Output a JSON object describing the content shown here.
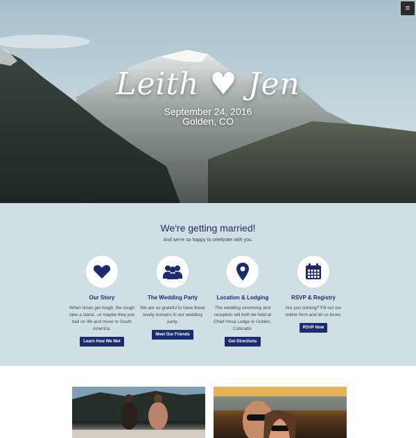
{
  "hero": {
    "names": "Leith ♥ Jen",
    "date": "September 24, 2016",
    "location": "Golden, CO"
  },
  "menu": {
    "icon": "hamburger-menu-icon",
    "glyph": "≡"
  },
  "intro": {
    "title": "We're getting married!",
    "subtitle": "And we're so happy to celebrate with you."
  },
  "features": [
    {
      "icon": "heart-icon",
      "title": "Our Story",
      "description": "When times get tough, the tough take a stand...or maybe they just bail on life and move to South America.",
      "button": "Learn How We Met"
    },
    {
      "icon": "group-icon",
      "title": "The Wedding Party",
      "description": "We are so grateful to have these lovely humans in our wedding party.",
      "button": "Meet Our Friends"
    },
    {
      "icon": "map-pin-icon",
      "title": "Location & Lodging",
      "description": "The wedding ceremony and reception will both be held at Chief Hosa Lodge in Golden, Colorado.",
      "button": "Get Directions"
    },
    {
      "icon": "calendar-icon",
      "title": "RSVP & Registry",
      "description": "Are you coming? Fill out our online form and let us know.",
      "button": "RSVP Now"
    }
  ],
  "colors": {
    "navy": "#1b2b6e",
    "section_bg": "#d0dfe4"
  }
}
